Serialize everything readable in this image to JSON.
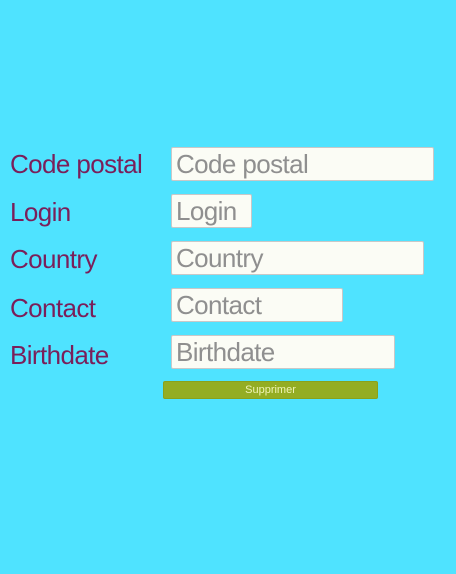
{
  "form": {
    "fields": [
      {
        "label": "Code postal",
        "placeholder": "Code postal",
        "value": ""
      },
      {
        "label": "Login",
        "placeholder": "Login",
        "value": ""
      },
      {
        "label": "Country",
        "placeholder": "Country",
        "value": ""
      },
      {
        "label": "Contact",
        "placeholder": "Contact",
        "value": ""
      },
      {
        "label": "Birthdate",
        "placeholder": "Birthdate",
        "value": ""
      }
    ],
    "submit_label": "Supprimer"
  },
  "colors": {
    "background": "#4fe3ff",
    "label_text": "#7a1f5a",
    "input_background": "#fbfcf5",
    "button_background": "#94ad23",
    "button_text": "#f0f3b3"
  }
}
